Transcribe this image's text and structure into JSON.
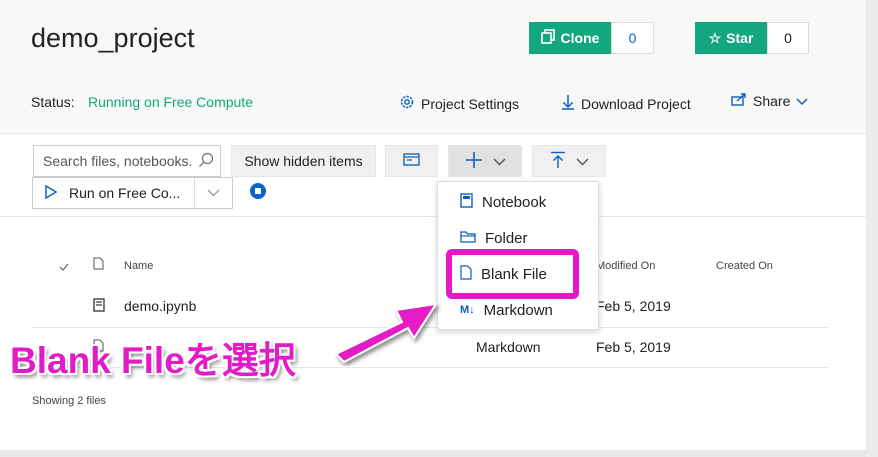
{
  "project": {
    "title": "demo_project",
    "clone_label": "Clone",
    "clone_count": "0",
    "star_label": "Star",
    "star_count": "0",
    "status_label": "Status:",
    "status_value": "Running on Free Compute",
    "project_settings_label": "Project Settings",
    "download_label": "Download Project",
    "share_label": "Share"
  },
  "toolbar": {
    "search_placeholder": "Search files, notebooks...",
    "search_shown": "Search files, notebooks.",
    "show_hidden_label": "Show hidden items",
    "run_label": "Run on Free Co..."
  },
  "table": {
    "columns": [
      "Name",
      "Modified On",
      "Created On"
    ],
    "rows": [
      {
        "name": "demo.ipynb",
        "type": "",
        "modified": "Feb 5, 2019"
      },
      {
        "name": "...",
        "type": "Markdown",
        "modified": "Feb 5, 2019"
      }
    ],
    "footer": "Showing 2 files"
  },
  "new_menu": {
    "items": [
      {
        "label": "Notebook",
        "icon": "notebook-icon"
      },
      {
        "label": "Folder",
        "icon": "folder-icon"
      },
      {
        "label": "Blank File",
        "icon": "file-icon"
      },
      {
        "label": "Markdown",
        "icon": "markdown-icon"
      }
    ]
  },
  "annotation": {
    "text": "Blank Fileを選択"
  },
  "colors": {
    "accent_green": "#13a780",
    "link_blue": "#0a5ebd",
    "annotation_magenta": "#e31bc6"
  }
}
